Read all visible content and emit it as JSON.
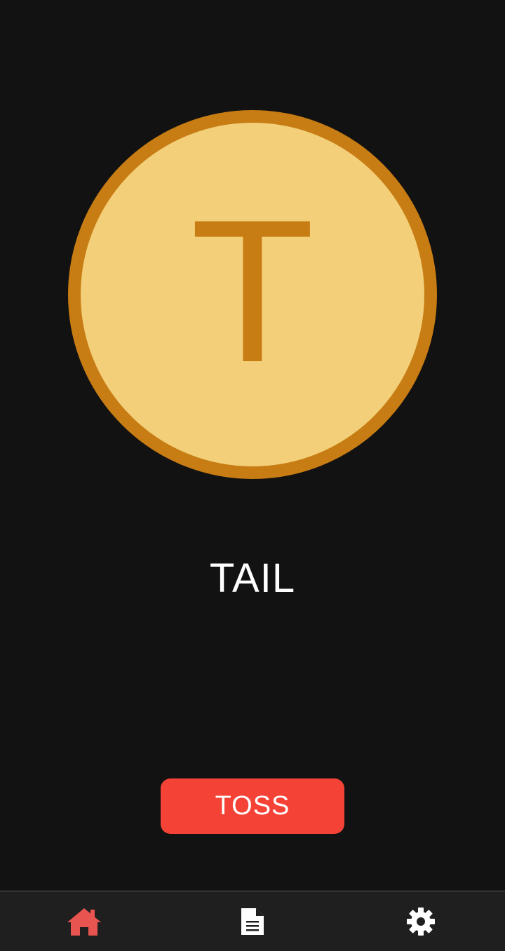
{
  "coin": {
    "face_letter": "T",
    "rim_color": "#c77d13",
    "fill_color": "#f3cf79"
  },
  "result": {
    "text": "TAIL"
  },
  "actions": {
    "toss_label": "TOSS",
    "toss_color": "#f44336"
  },
  "bottom_nav": {
    "items": [
      {
        "icon": "home-icon",
        "active": true,
        "color": "#e85450"
      },
      {
        "icon": "document-icon",
        "active": false,
        "color": "#ffffff"
      },
      {
        "icon": "gear-icon",
        "active": false,
        "color": "#ffffff"
      }
    ]
  }
}
